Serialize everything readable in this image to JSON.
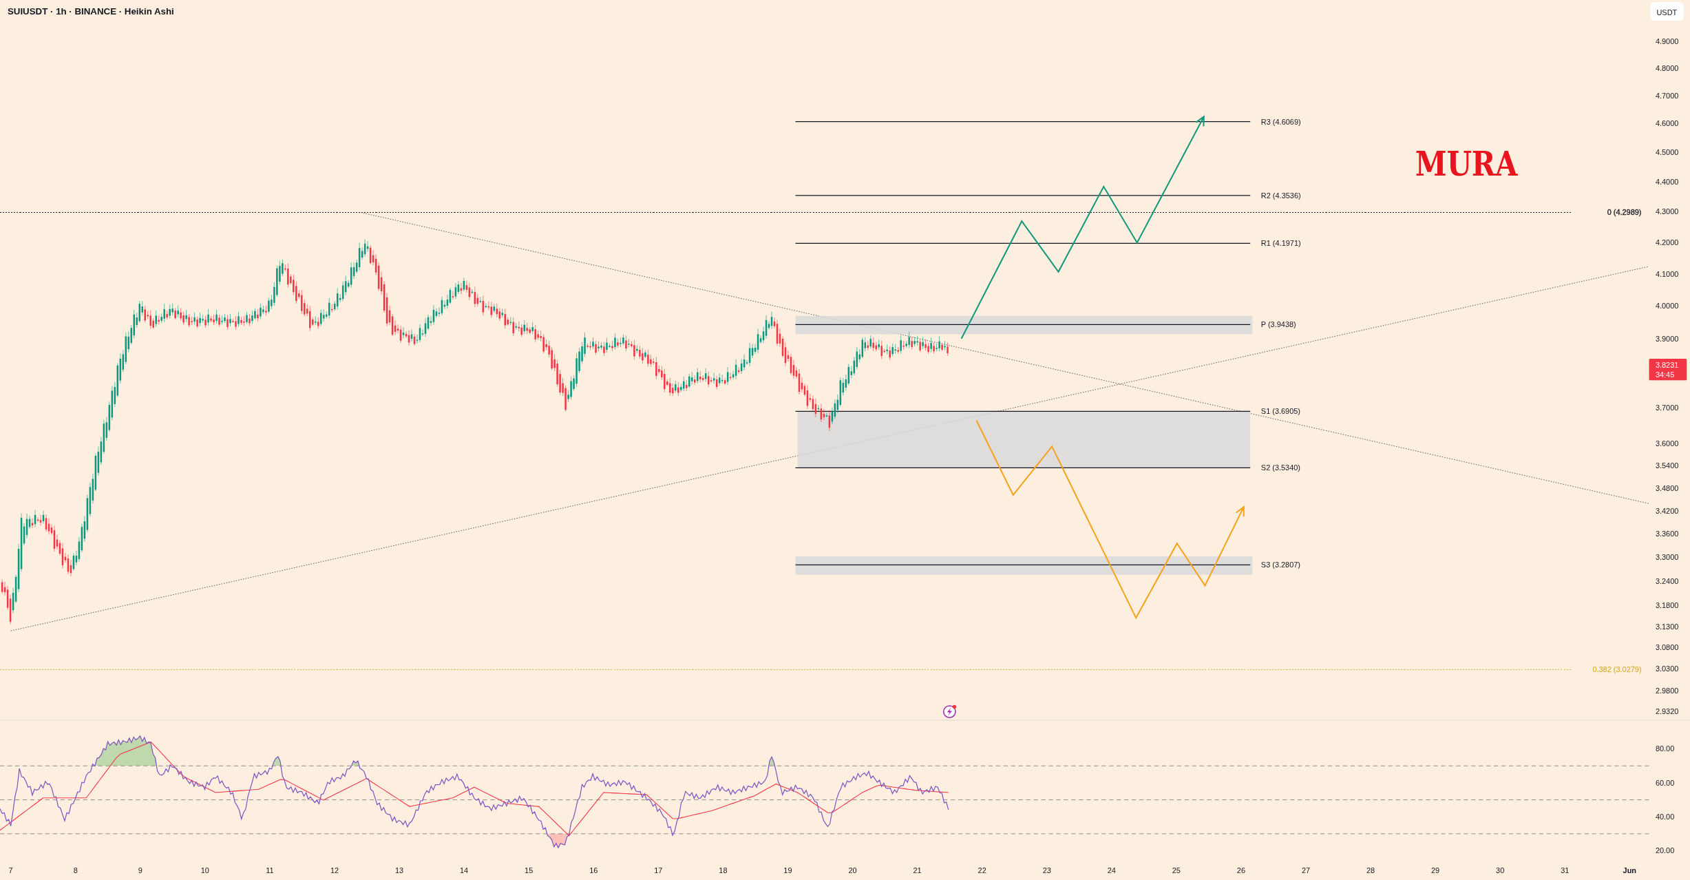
{
  "header": {
    "title": "SUIUSDT · 1h · BINANCE · Heikin Ashi"
  },
  "currency_button": {
    "label": "USDT"
  },
  "logo": {
    "text": "MURA"
  },
  "price_axis": {
    "ticks": [
      "4.9000",
      "4.8000",
      "4.7000",
      "4.6000",
      "4.5000",
      "4.4000",
      "4.3000",
      "4.2000",
      "4.1000",
      "4.0000",
      "3.9000",
      "3.7000",
      "3.6000",
      "3.5400",
      "3.4800",
      "3.4200",
      "3.3600",
      "3.3000",
      "3.2400",
      "3.1800",
      "3.1300",
      "3.0800",
      "3.0300",
      "2.9800",
      "2.9320"
    ],
    "last_price": {
      "price": "3.8231",
      "countdown": "34:45"
    }
  },
  "pivot_levels": [
    {
      "label": "R3 (4.6069)",
      "kind": "line"
    },
    {
      "label": "R2 (4.3536)",
      "kind": "line"
    },
    {
      "label": "R1 (4.1971)",
      "kind": "line"
    },
    {
      "label": "P (3.9438)",
      "kind": "band"
    },
    {
      "label": "S1 (3.6905)",
      "kind": "zone_top"
    },
    {
      "label": "S2 (3.5340)",
      "kind": "zone_bottom"
    },
    {
      "label": "S3 (3.2807)",
      "kind": "band"
    }
  ],
  "fib_levels": [
    {
      "label": "0 (4.2989)",
      "color": "#131722"
    },
    {
      "label": "0.382 (3.0279)",
      "color": "#d9b840"
    }
  ],
  "rsi_axis": {
    "ticks": [
      "80.00",
      "60.00",
      "40.00",
      "20.00"
    ]
  },
  "time_axis": {
    "ticks": [
      {
        "label": "7",
        "kind": "day"
      },
      {
        "label": "8",
        "kind": "day"
      },
      {
        "label": "9",
        "kind": "day"
      },
      {
        "label": "10",
        "kind": "day"
      },
      {
        "label": "11",
        "kind": "day"
      },
      {
        "label": "12",
        "kind": "day"
      },
      {
        "label": "13",
        "kind": "day"
      },
      {
        "label": "14",
        "kind": "day"
      },
      {
        "label": "15",
        "kind": "day"
      },
      {
        "label": "16",
        "kind": "day"
      },
      {
        "label": "17",
        "kind": "day"
      },
      {
        "label": "18",
        "kind": "day"
      },
      {
        "label": "19",
        "kind": "day"
      },
      {
        "label": "20",
        "kind": "day"
      },
      {
        "label": "21",
        "kind": "day"
      },
      {
        "label": "22",
        "kind": "day"
      },
      {
        "label": "23",
        "kind": "day"
      },
      {
        "label": "24",
        "kind": "day"
      },
      {
        "label": "25",
        "kind": "day"
      },
      {
        "label": "26",
        "kind": "day"
      },
      {
        "label": "27",
        "kind": "day"
      },
      {
        "label": "28",
        "kind": "day"
      },
      {
        "label": "29",
        "kind": "day"
      },
      {
        "label": "30",
        "kind": "day"
      },
      {
        "label": "31",
        "kind": "day"
      },
      {
        "label": "Jun",
        "kind": "month"
      }
    ]
  }
}
